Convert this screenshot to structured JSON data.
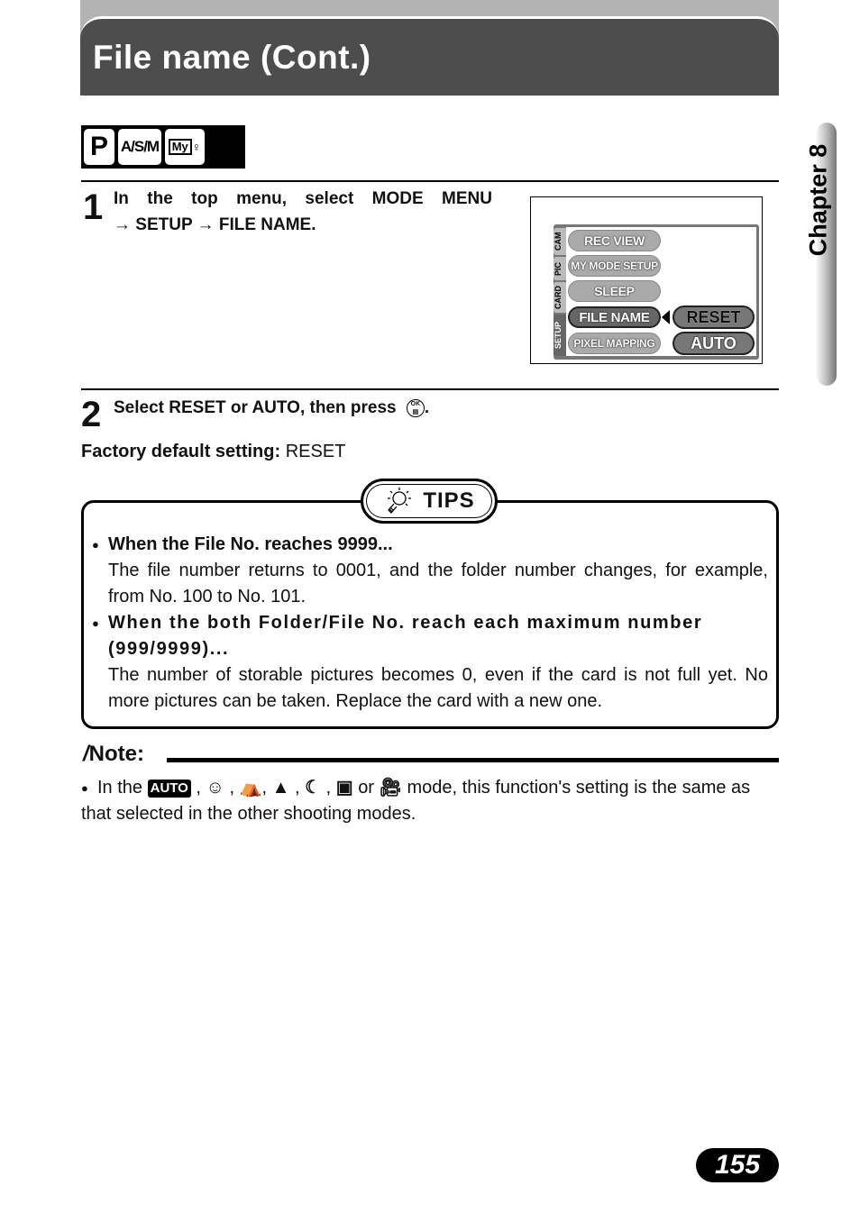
{
  "header": {
    "title": "File name (Cont.)"
  },
  "mode_icons": [
    {
      "name": "p-mode-icon",
      "label": "P"
    },
    {
      "name": "asm-mode-icon",
      "label": "A/S/M"
    },
    {
      "name": "my-mode-icon",
      "label": "My"
    }
  ],
  "steps": [
    {
      "number": "1",
      "text_line1": "In the top menu, select MODE MENU",
      "text_line2": "→ SETUP → FILE NAME."
    },
    {
      "number": "2",
      "text": "Select RESET or AUTO, then press",
      "icon": "ok-button-icon",
      "suffix": "."
    }
  ],
  "camera_screen": {
    "tabs": [
      "CAM",
      "PIC",
      "CARD",
      "SETUP"
    ],
    "active_tab": "SETUP",
    "menu_items": [
      "REC VIEW",
      "MY MODE SETUP",
      "SLEEP",
      "FILE NAME",
      "PIXEL MAPPING"
    ],
    "selected_item": "FILE NAME",
    "options": [
      "RESET",
      "AUTO"
    ],
    "selected_option": "RESET"
  },
  "default_setting": {
    "label": "Factory default setting:",
    "value": "RESET"
  },
  "tips": {
    "title": "TIPS",
    "items": [
      {
        "heading": "When the File No. reaches 9999...",
        "body": "The file number returns to 0001, and the folder number changes, for example, from No. 100 to No. 101."
      },
      {
        "heading": "When the both Folder/File No. reach each maximum number (999/9999)...",
        "body": "The number of storable pictures becomes 0, even if the card is not full yet. No more pictures can be taken. Replace the card with a new one."
      }
    ]
  },
  "note": {
    "label": "Note:",
    "prefix": "In the",
    "auto_icon": "AUTO",
    "or": "or",
    "suffix": "mode, this function's setting is the same as that selected in the other shooting modes."
  },
  "sidebar": {
    "chapter": "Chapter 8"
  },
  "page_number": "155"
}
